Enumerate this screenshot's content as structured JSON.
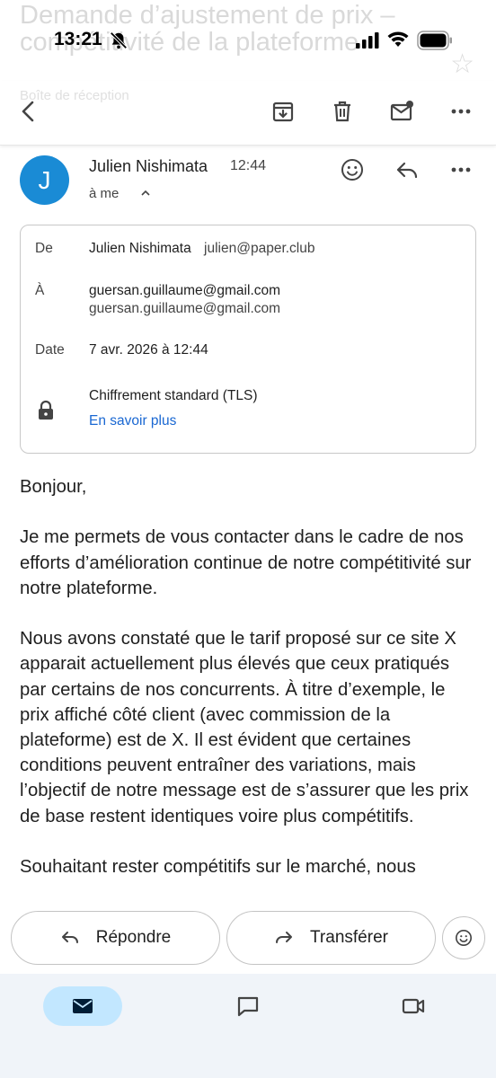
{
  "header": {
    "subject_line1": "Demande d’ajustement de prix –",
    "subject_line2": "compétitivité de la plateforme",
    "folder": "Boîte de réception"
  },
  "status": {
    "time": "13:21"
  },
  "toolbar": {
    "back_icon": "arrow-back-icon",
    "archive_icon": "archive-icon",
    "delete_icon": "trash-icon",
    "mark_unread_icon": "mail-unread-icon",
    "more_icon": "more-horizontal-icon"
  },
  "message": {
    "avatar_letter": "J",
    "sender_name": "Julien Nishimata",
    "time": "12:44",
    "to": "à me"
  },
  "details": {
    "from_label": "De",
    "from_name": "Julien Nishimata",
    "from_email": "julien@paper.club",
    "to_label": "À",
    "to_email_1": "guersan.guillaume@gmail.com",
    "to_email_2": "guersan.guillaume@gmail.com",
    "date_label": "Date",
    "date_value": "7 avr. 2026 à 12:44",
    "encryption": "Chiffrement standard (TLS)",
    "learn_more": "En savoir plus"
  },
  "body": {
    "greeting": "Bonjour,",
    "p1": "Je me permets de vous contacter dans le cadre de nos efforts d’amélioration continue de notre compétitivité sur notre plateforme.",
    "p2": "Nous avons constaté que le tarif proposé sur ce site X apparait actuellement plus élevés que ceux pratiqués par certains de nos concurrents. À titre d’exemple, le prix affiché côté client (avec commission de la plateforme) est de X. Il est évident que certaines conditions peuvent entraîner des variations, mais l’objectif de notre message est de s’assurer que les prix de base restent identiques voire plus compétitifs.",
    "p3": "Souhaitant rester compétitifs sur le marché, nous"
  },
  "actions": {
    "reply": "Répondre",
    "forward": "Transférer"
  },
  "colors": {
    "avatar": "#1a8bd5",
    "link": "#1967d2",
    "nav_bg": "#f0f4f9",
    "nav_active": "#c2e7ff"
  }
}
